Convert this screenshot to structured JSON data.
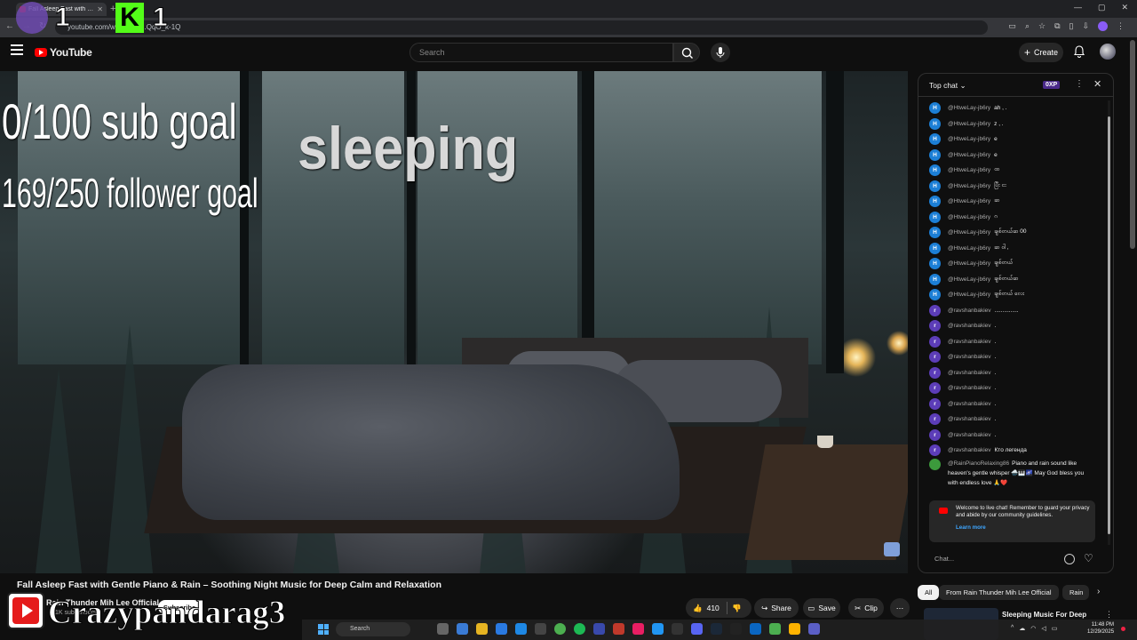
{
  "browser": {
    "tab_title": "Fall Asleep Fast with Gentle",
    "url": "youtube.com/watch?v=...QqO_k-1Q"
  },
  "overlay": {
    "viewer_count_1": "1",
    "viewer_count_2": "1",
    "kick_letter": "K",
    "sub_goal": "0/100 sub goal",
    "follower_goal": "169/250 follower goal",
    "status": "sleeping",
    "streamer_name": "Crazypandarag3"
  },
  "header": {
    "logo_text": "YouTube",
    "search_placeholder": "Search",
    "create_label": "Create"
  },
  "video": {
    "title": "Fall Asleep Fast with Gentle Piano & Rain – Soothing Night Music for Deep Calm and Relaxation",
    "channel": "Rain Thunder Mih Lee Official",
    "subscribers": "1K subscribers",
    "subscribe_label": "Subscribe",
    "likes": "410",
    "share_label": "Share",
    "save_label": "Save",
    "clip_label": "Clip"
  },
  "chat": {
    "mode_label": "Top chat",
    "xp_label": "0XP",
    "messages": [
      {
        "author": "@HtweLay-jb6ry",
        "text": "ah , .",
        "initial": "H"
      },
      {
        "author": "@HtweLay-jb6ry",
        "text": "z , .",
        "initial": "H"
      },
      {
        "author": "@HtweLay-jb6ry",
        "text": "e",
        "initial": "H"
      },
      {
        "author": "@HtweLay-jb6ry",
        "text": "e",
        "initial": "H"
      },
      {
        "author": "@HtweLay-jb6ry",
        "text": "ထ",
        "initial": "H"
      },
      {
        "author": "@HtweLay-jb6ry",
        "text": "ပြီး ငး",
        "initial": "H"
      },
      {
        "author": "@HtweLay-jb6ry",
        "text": "ဆ",
        "initial": "H"
      },
      {
        "author": "@HtweLay-jb6ry",
        "text": "ဂ",
        "initial": "H"
      },
      {
        "author": "@HtweLay-jb6ry",
        "text": "ချစ်တယ်ဆ 00",
        "initial": "H"
      },
      {
        "author": "@HtweLay-jb6ry",
        "text": "ဆ ဝါ ,",
        "initial": "H"
      },
      {
        "author": "@HtweLay-jb6ry",
        "text": "ချစ်တယ်",
        "initial": "H"
      },
      {
        "author": "@HtweLay-jb6ry",
        "text": "ချစ်တယ်ဆ",
        "initial": "H"
      },
      {
        "author": "@HtweLay-jb6ry",
        "text": "ချစ်တယ် လေး",
        "initial": "H"
      },
      {
        "author": "@ravshanbakiev",
        "text": "...............",
        "initial": "r"
      },
      {
        "author": "@ravshanbakiev",
        "text": ".",
        "initial": "r"
      },
      {
        "author": "@ravshanbakiev",
        "text": ".",
        "initial": "r"
      },
      {
        "author": "@ravshanbakiev",
        "text": ".",
        "initial": "r"
      },
      {
        "author": "@ravshanbakiev",
        "text": ".",
        "initial": "r"
      },
      {
        "author": "@ravshanbakiev",
        "text": ".",
        "initial": "r"
      },
      {
        "author": "@ravshanbakiev",
        "text": ".",
        "initial": "r"
      },
      {
        "author": "@ravshanbakiev",
        "text": ".",
        "initial": "r"
      },
      {
        "author": "@ravshanbakiev",
        "text": ".",
        "initial": "r"
      },
      {
        "author": "@ravshanbakiev",
        "text": "Кто легенда",
        "initial": "r"
      }
    ],
    "long_message": {
      "author": "@RainPianoRelaxing86",
      "text": "Piano and rain sound like heaven's gentle whisper 🌧️🎹🌌 May God bless you with endless love 🙏❤️"
    },
    "welcome_text": "Welcome to live chat! Remember to guard your privacy and abide by our community guidelines.",
    "learn_more": "Learn more",
    "input_placeholder": "Chat..."
  },
  "chips": {
    "all": "All",
    "from_channel": "From Rain Thunder Mih Lee Official",
    "rain": "Rain"
  },
  "recommendation": {
    "title": "Sleeping Music For Deep"
  },
  "taskbar": {
    "search_label": "Search",
    "time": "11:48 PM",
    "date": "12/29/2025"
  },
  "colors": {
    "youtube_red": "#ff0000",
    "kick_green": "#53fc18",
    "accent_blue": "#3ea6ff",
    "handle_blue_avatar": "#1c7fd6",
    "handle_purple_avatar": "#5c3db8"
  }
}
